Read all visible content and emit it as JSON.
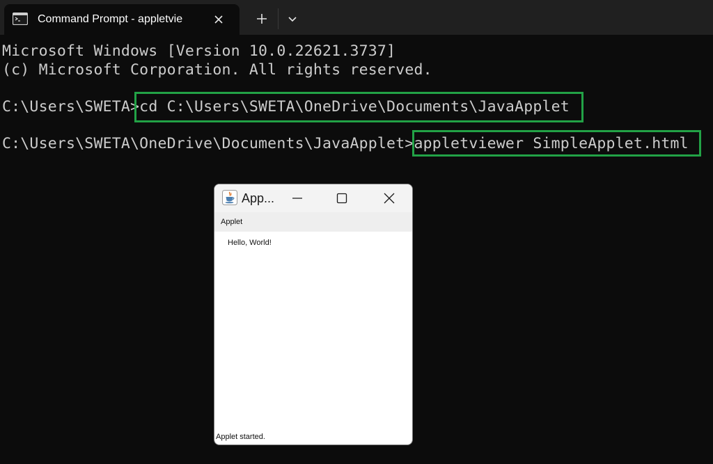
{
  "terminal": {
    "tab_title": "Command Prompt - appletvie",
    "tab_icon": "terminal-icon",
    "new_tab_icon": "plus-icon",
    "dropdown_icon": "chevron-down-icon",
    "close_icon": "close-icon",
    "lines": {
      "version": "Microsoft Windows [Version 10.0.22621.3737]",
      "copyright": "(c) Microsoft Corporation. All rights reserved.",
      "prompt1": "C:\\Users\\SWETA>",
      "command1": "cd C:\\Users\\SWETA\\OneDrive\\Documents\\JavaApplet",
      "prompt2": "C:\\Users\\SWETA\\OneDrive\\Documents\\JavaApplet>",
      "command2": "appletviewer SimpleApplet.html"
    },
    "highlight_color": "#22a246"
  },
  "applet_window": {
    "title": "App...",
    "icon": "java-cup-icon",
    "minimize_icon": "minimize-icon",
    "maximize_icon": "maximize-icon",
    "close_icon": "close-icon",
    "menu_label": "Applet",
    "message": "Hello, World!",
    "status": "Applet started."
  }
}
